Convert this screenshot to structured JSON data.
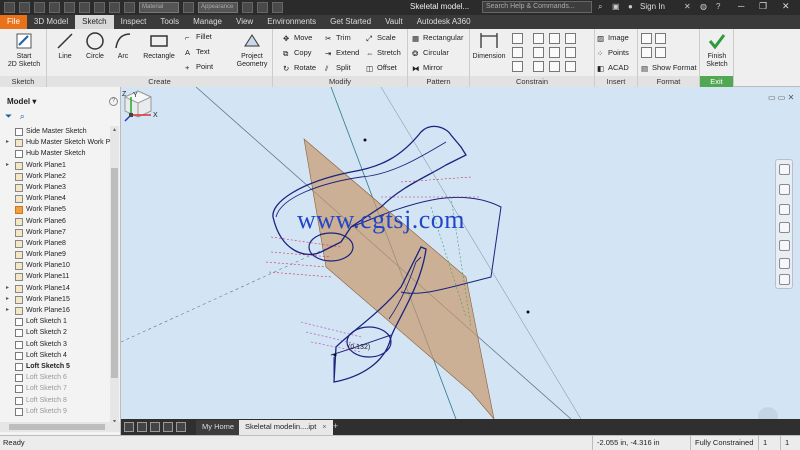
{
  "titlebar": {
    "qat_dropdown_1": "Material",
    "qat_dropdown_2": "Appearance",
    "document_title": "Skeletal model...",
    "search_placeholder": "Search Help & Commands...",
    "sign_in": "Sign In",
    "help": "?"
  },
  "tabs": [
    {
      "label": "File"
    },
    {
      "label": "3D Model"
    },
    {
      "label": "Sketch"
    },
    {
      "label": "Inspect"
    },
    {
      "label": "Tools"
    },
    {
      "label": "Manage"
    },
    {
      "label": "View"
    },
    {
      "label": "Environments"
    },
    {
      "label": "Get Started"
    },
    {
      "label": "Vault"
    },
    {
      "label": "Autodesk A360"
    }
  ],
  "ribbon": {
    "sketch_panel": {
      "label": "Sketch",
      "start_line1": "Start",
      "start_line2": "2D Sketch"
    },
    "create_panel": {
      "label": "Create",
      "line": "Line",
      "circle": "Circle",
      "arc": "Arc",
      "rectangle": "Rectangle",
      "fillet": "Fillet",
      "text": "Text",
      "point": "Point",
      "project_line1": "Project",
      "project_line2": "Geometry"
    },
    "modify_panel": {
      "label": "Modify",
      "move": "Move",
      "trim": "Trim",
      "scale": "Scale",
      "copy": "Copy",
      "extend": "Extend",
      "stretch": "Stretch",
      "rotate": "Rotate",
      "split": "Split",
      "offset": "Offset"
    },
    "pattern_panel": {
      "label": "Pattern",
      "rectangular": "Rectangular",
      "circular": "Circular",
      "mirror": "Mirror"
    },
    "constrain_panel": {
      "label": "Constrain",
      "dimension": "Dimension"
    },
    "insert_panel": {
      "label": "Insert",
      "image": "Image",
      "points": "Points",
      "acad": "ACAD"
    },
    "format_panel": {
      "label": "Format",
      "show_format": "Show Format"
    },
    "exit_panel": {
      "label": "Exit",
      "finish_line1": "Finish",
      "finish_line2": "Sketch"
    }
  },
  "browser": {
    "title": "Model",
    "items": [
      {
        "label": "Side Master Sketch",
        "expand": "",
        "icon": "sketch-icon",
        "style": ""
      },
      {
        "label": "Hub Master Sketch Work Pl...",
        "expand": "▸",
        "icon": "work-plane-icon",
        "style": ""
      },
      {
        "label": "Hub Master Sketch",
        "expand": "",
        "icon": "sketch-icon",
        "style": ""
      },
      {
        "label": "Work Plane1",
        "expand": "▸",
        "icon": "work-plane-icon",
        "style": ""
      },
      {
        "label": "Work Plane2",
        "expand": "",
        "icon": "work-plane-icon",
        "style": ""
      },
      {
        "label": "Work Plane3",
        "expand": "",
        "icon": "work-plane-icon",
        "style": ""
      },
      {
        "label": "Work Plane4",
        "expand": "",
        "icon": "work-plane-icon",
        "style": ""
      },
      {
        "label": "Work Plane5",
        "expand": "",
        "icon": "work-plane-icon",
        "style": "highlight"
      },
      {
        "label": "Work Plane6",
        "expand": "",
        "icon": "work-plane-icon",
        "style": ""
      },
      {
        "label": "Work Plane7",
        "expand": "",
        "icon": "work-plane-icon",
        "style": ""
      },
      {
        "label": "Work Plane8",
        "expand": "",
        "icon": "work-plane-icon",
        "style": ""
      },
      {
        "label": "Work Plane9",
        "expand": "",
        "icon": "work-plane-icon",
        "style": ""
      },
      {
        "label": "Work Plane10",
        "expand": "",
        "icon": "work-plane-icon",
        "style": ""
      },
      {
        "label": "Work Plane11",
        "expand": "",
        "icon": "work-plane-icon",
        "style": ""
      },
      {
        "label": "Work Plane14",
        "expand": "▸",
        "icon": "work-plane-icon",
        "style": ""
      },
      {
        "label": "Work Plane15",
        "expand": "▸",
        "icon": "work-plane-icon",
        "style": ""
      },
      {
        "label": "Work Plane16",
        "expand": "▸",
        "icon": "work-plane-icon",
        "style": ""
      },
      {
        "label": "Loft Sketch 1",
        "expand": "",
        "icon": "sketch-icon",
        "style": ""
      },
      {
        "label": "Loft Sketch 2",
        "expand": "",
        "icon": "sketch-icon",
        "style": ""
      },
      {
        "label": "Loft Sketch 3",
        "expand": "",
        "icon": "sketch-icon",
        "style": ""
      },
      {
        "label": "Loft Sketch 4",
        "expand": "",
        "icon": "sketch-icon",
        "style": ""
      },
      {
        "label": "Loft Sketch 5",
        "expand": "",
        "icon": "sketch-icon",
        "style": "bold"
      },
      {
        "label": "Loft Sketch 6",
        "expand": "",
        "icon": "sketch-icon",
        "style": "dim"
      },
      {
        "label": "Loft Sketch 7",
        "expand": "",
        "icon": "sketch-icon",
        "style": "dim"
      },
      {
        "label": "Loft Sketch 8",
        "expand": "",
        "icon": "sketch-icon",
        "style": "dim"
      },
      {
        "label": "Loft Sketch 9",
        "expand": "",
        "icon": "sketch-icon",
        "style": "dim"
      }
    ]
  },
  "viewport": {
    "watermark": "www.cgtsj.com",
    "dimension_label": "(0.132)",
    "triad_x": "X",
    "triad_y": "Y",
    "triad_z": "Z"
  },
  "doctabs": {
    "home": "My Home",
    "active": "Skeletal modelin....ipt",
    "close": "×",
    "add": "+"
  },
  "status": {
    "ready": "Ready",
    "coords": "-2.055 in, -4.316 in",
    "constraint": "Fully Constrained",
    "count1": "1",
    "count2": "1"
  },
  "colors": {
    "file_tab": "#e8711a",
    "viewport_bg": "#d3e4f5",
    "sketch_lines": "#1a237e",
    "work_plane": "#c89a6e",
    "exit_green": "#52a852"
  }
}
